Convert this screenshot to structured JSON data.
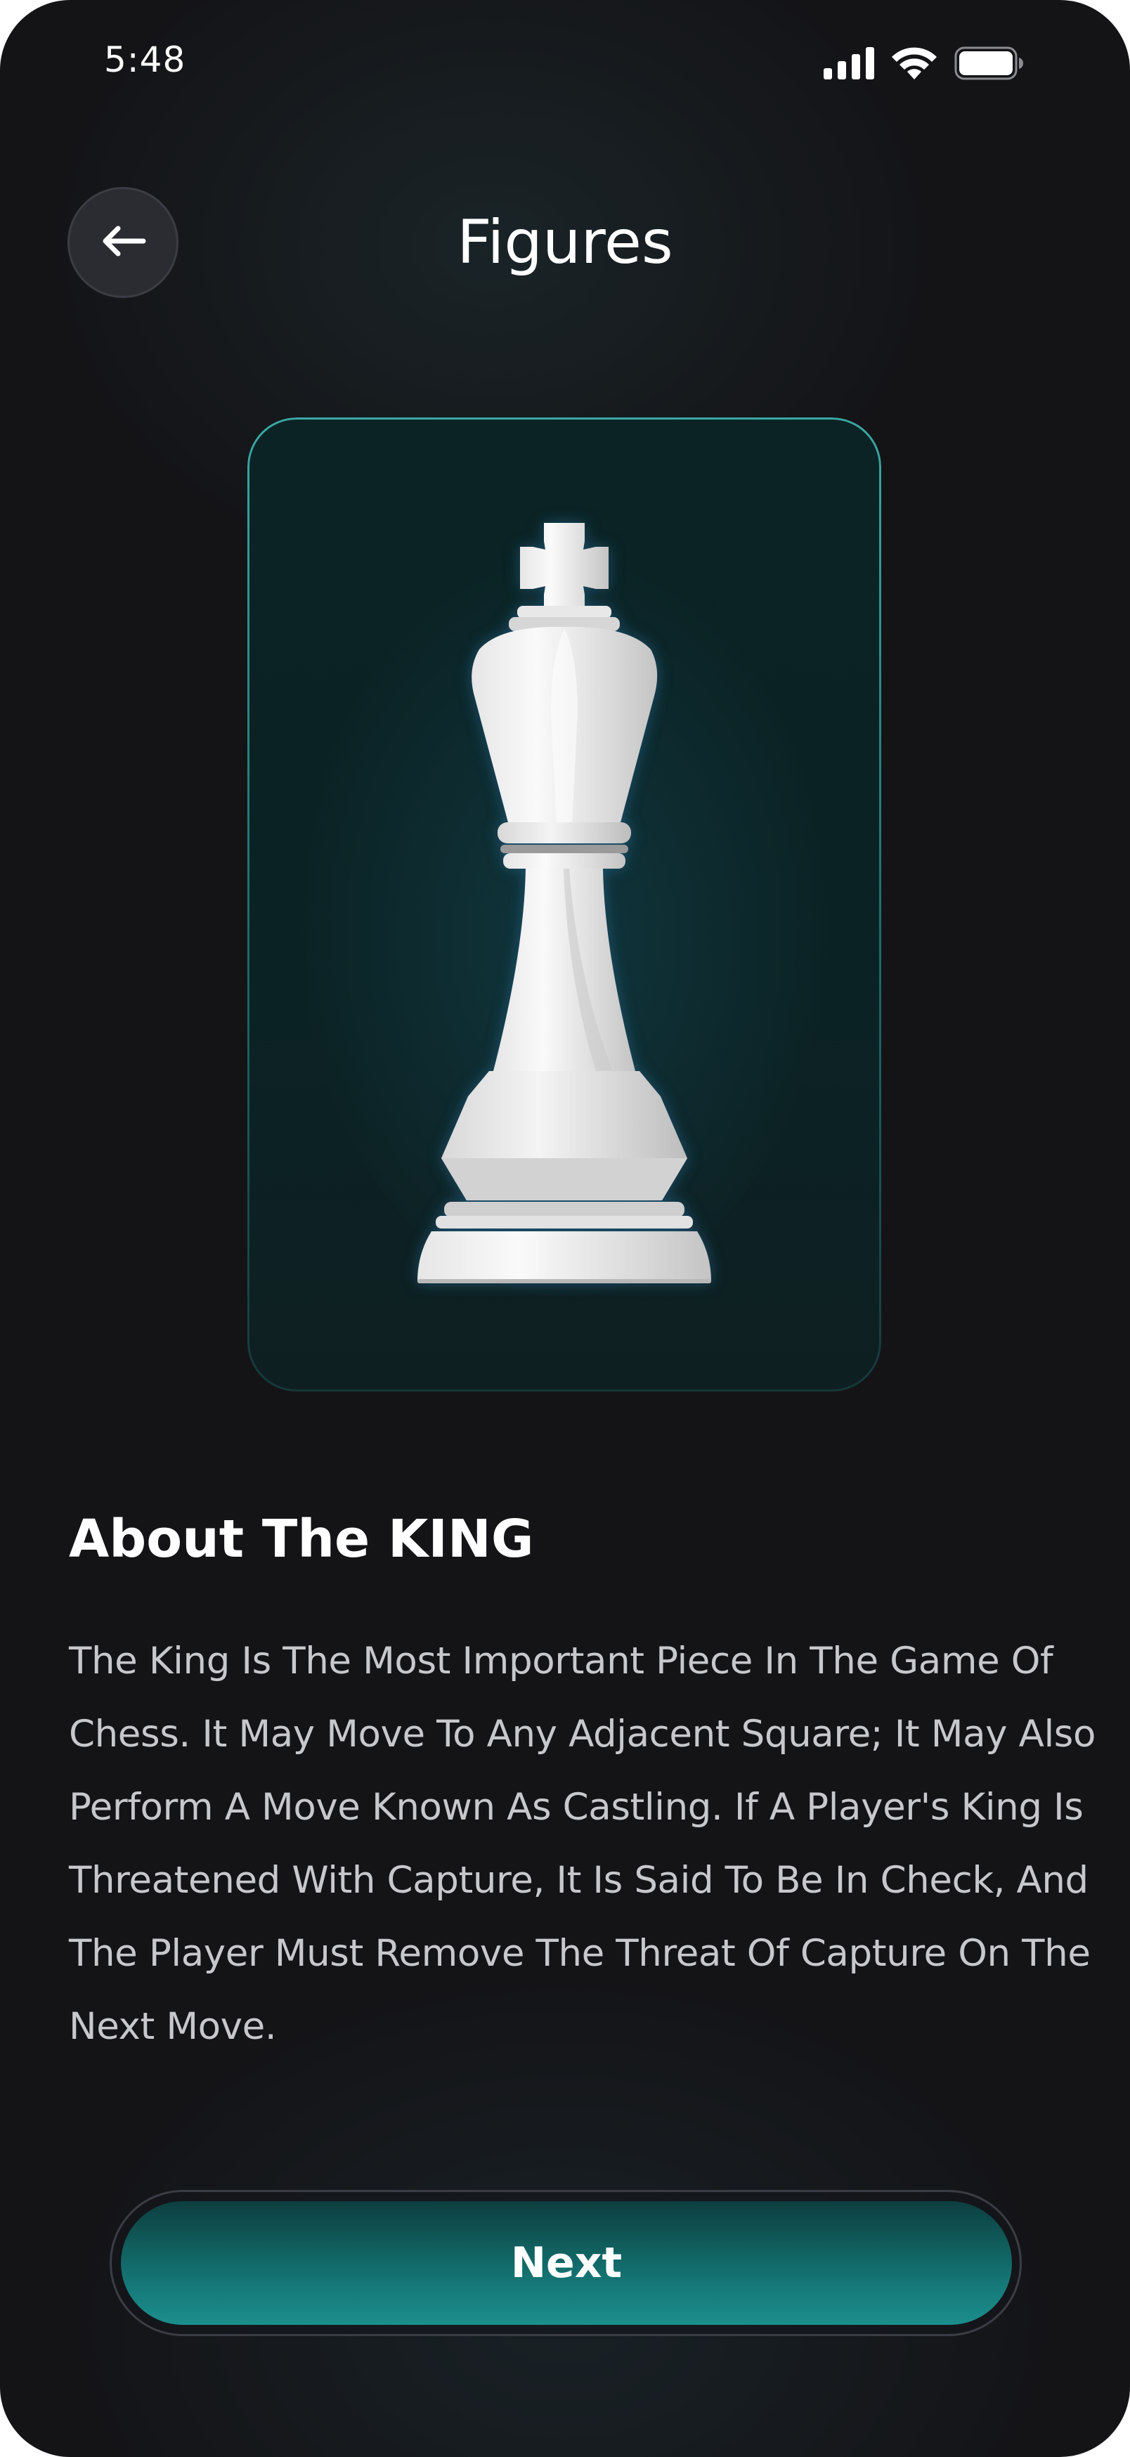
{
  "status_bar": {
    "time": "5:48"
  },
  "header": {
    "title": "Figures",
    "back_icon": "arrow-left-icon"
  },
  "piece": {
    "image": "white-chess-king",
    "card_accent": "#3aa9a5"
  },
  "about": {
    "heading": "About The KING",
    "body": "The King Is The Most Important Piece In The Game Of Chess. It May Move To Any Adjacent Square; It May Also Perform A Move Known As Castling. If A Player's King Is Threatened With Capture, It Is Said To Be In Check, And The Player Must Remove The Threat Of Capture On The Next Move."
  },
  "next_button": {
    "label": "Next",
    "color": "#1b8e8c"
  },
  "colors": {
    "background": "#141417",
    "text_primary": "#ffffff",
    "text_secondary": "#c6c8cc"
  }
}
